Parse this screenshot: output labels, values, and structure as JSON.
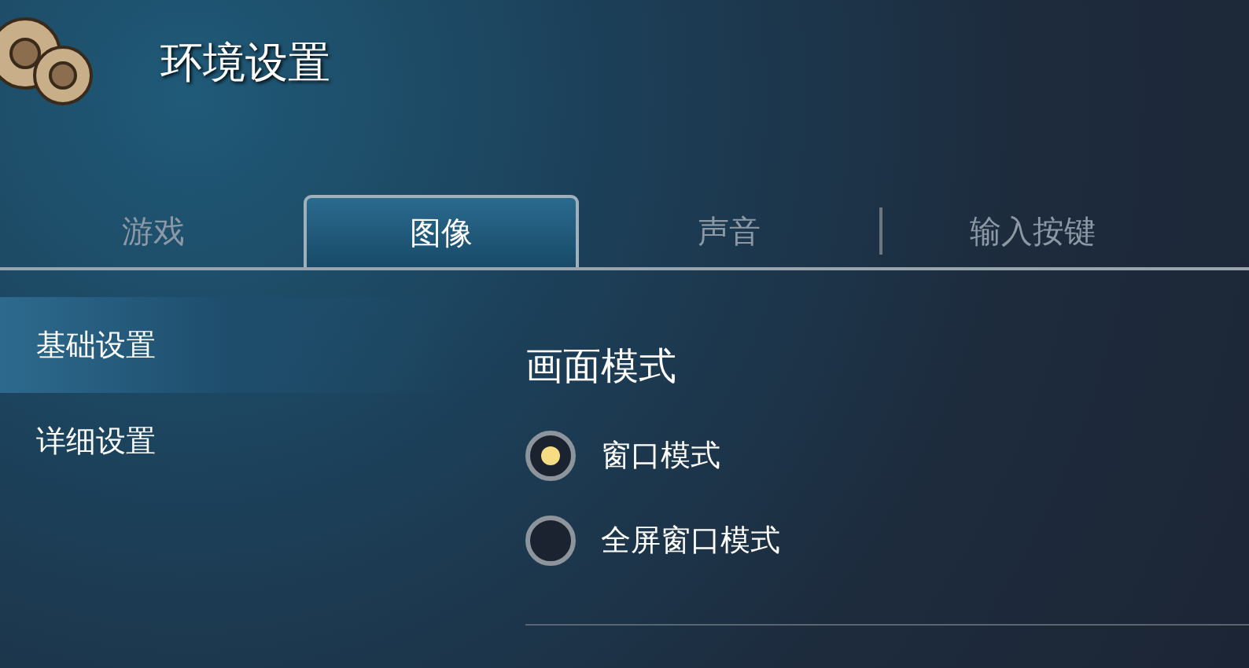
{
  "window": {
    "title": "环境设置"
  },
  "tabs": [
    {
      "label": "游戏",
      "selected": false
    },
    {
      "label": "图像",
      "selected": true
    },
    {
      "label": "声音",
      "selected": false
    },
    {
      "label": "输入按键",
      "selected": false
    }
  ],
  "sidebar": {
    "items": [
      {
        "label": "基础设置",
        "selected": true
      },
      {
        "label": "详细设置",
        "selected": false
      }
    ]
  },
  "section": {
    "title": "画面模式",
    "options": [
      {
        "label": "窗口模式",
        "selected": true
      },
      {
        "label": "全屏窗口模式",
        "selected": false
      }
    ]
  }
}
